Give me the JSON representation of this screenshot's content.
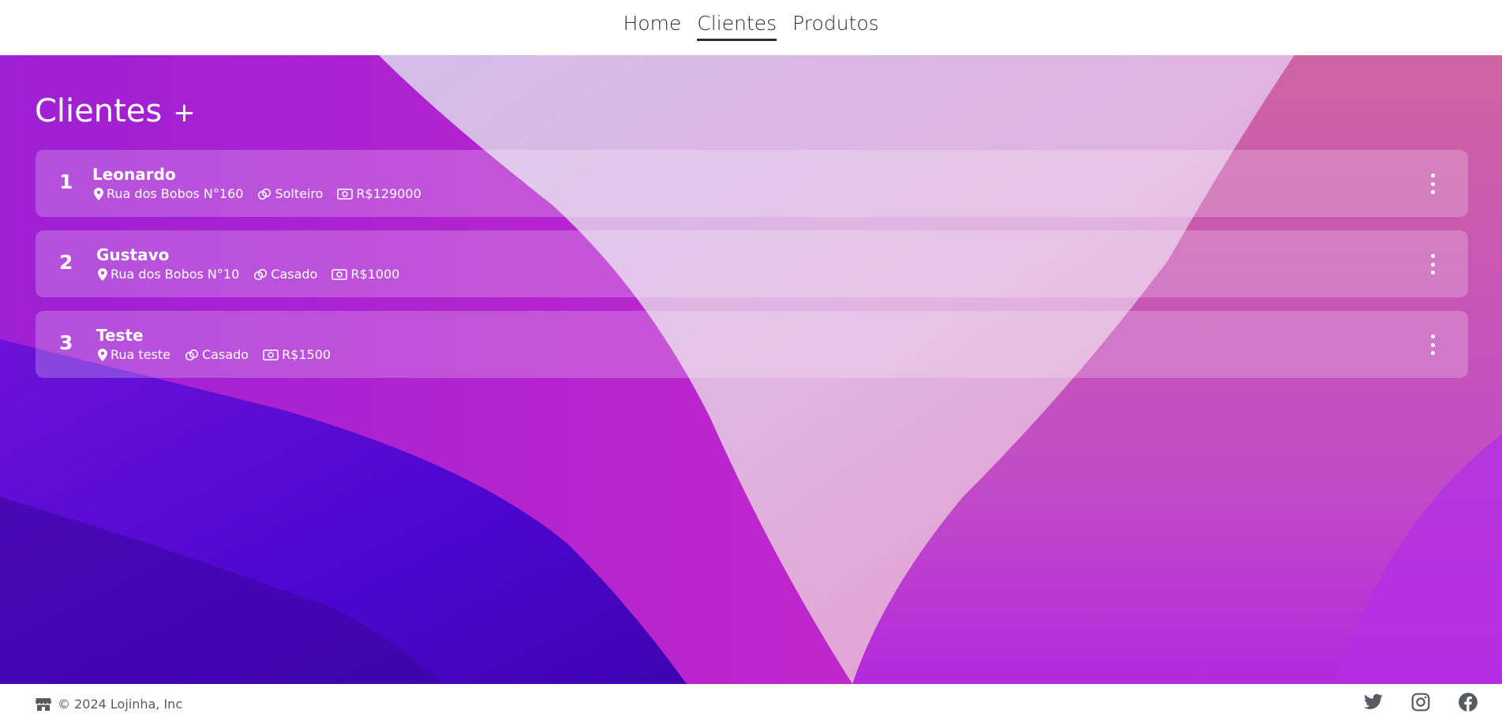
{
  "nav": {
    "links": [
      {
        "label": "Home",
        "active": false
      },
      {
        "label": "Clientes",
        "active": true
      },
      {
        "label": "Produtos",
        "active": false
      }
    ]
  },
  "page": {
    "title": "Clientes",
    "add_label": "+"
  },
  "clients": [
    {
      "id": "1",
      "name": "Leonardo",
      "address": "Rua dos Bobos N°160",
      "marital_status": "Solteiro",
      "income": "R$129000"
    },
    {
      "id": "2",
      "name": "Gustavo",
      "address": "Rua dos Bobos N°10",
      "marital_status": "Casado",
      "income": "R$1000"
    },
    {
      "id": "3",
      "name": "Teste",
      "address": "Rua teste",
      "marital_status": "Casado",
      "income": "R$1500"
    }
  ],
  "footer": {
    "copyright": "© 2024 Lojinha, Inc",
    "store_icon": "store-icon",
    "social_icons": [
      "twitter-icon",
      "instagram-icon",
      "facebook-icon"
    ]
  },
  "colors": {
    "text_dark": "#2c2c2c",
    "footer_text": "#555b63",
    "bg_purple": "#a81fd0",
    "bg_pink": "#d56fbf"
  }
}
